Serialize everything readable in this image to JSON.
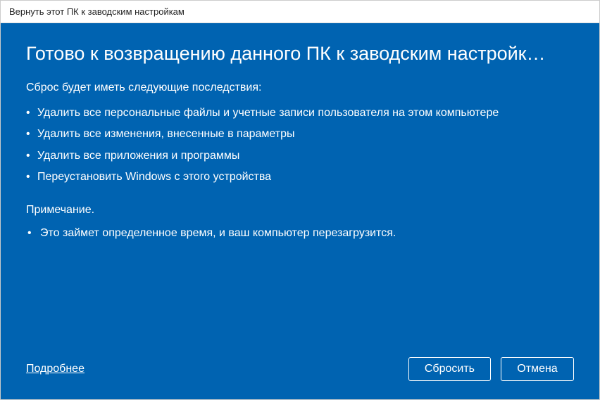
{
  "window": {
    "title": "Вернуть этот ПК к заводским настройкам"
  },
  "content": {
    "heading": "Готово к возвращению данного ПК к заводским настройк…",
    "intro": "Сброс будет иметь следующие последствия:",
    "bullets": {
      "0": "Удалить все персональные файлы и учетные записи пользователя на этом компьютере",
      "1": "Удалить все изменения, внесенные в параметры",
      "2": "Удалить все приложения и программы",
      "3": "Переустановить Windows с этого устройства"
    },
    "note_heading": "Примечание.",
    "notes": {
      "0": "Это займет определенное время, и ваш компьютер перезагрузится."
    }
  },
  "footer": {
    "learn_more": "Подробнее",
    "reset_button": "Сбросить",
    "cancel_button": "Отмена"
  },
  "colors": {
    "accent": "#0063B1"
  }
}
